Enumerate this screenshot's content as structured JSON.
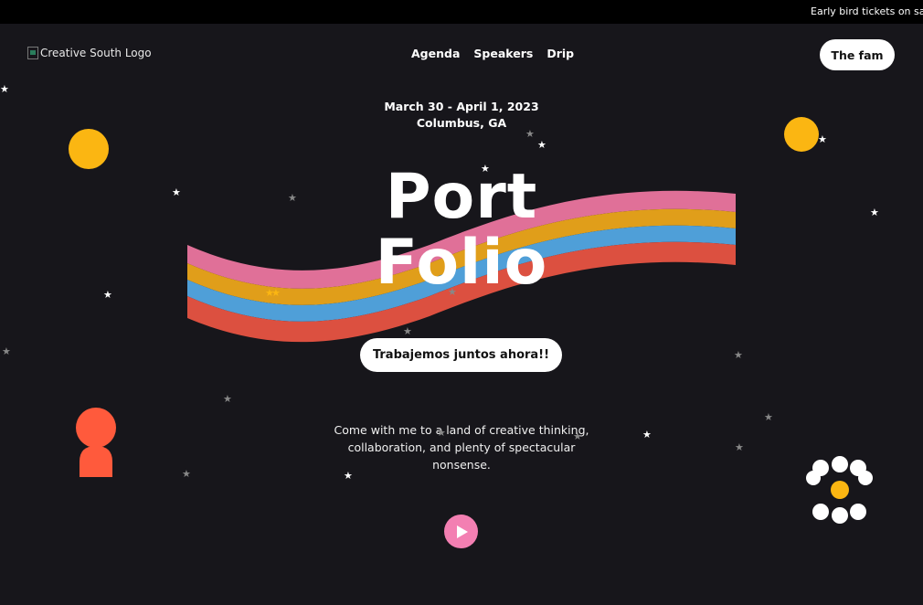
{
  "announcement": {
    "text": "Early bird tickets on sale"
  },
  "header": {
    "logo_alt": "Creative South Logo",
    "nav": [
      "Agenda",
      "Speakers",
      "Drip"
    ],
    "cta_label": "The fam"
  },
  "event": {
    "dates": "March 30 - April 1, 2023",
    "location": "Columbus, GA"
  },
  "hero": {
    "title_line1": "Port",
    "title_line2": "Folio",
    "cta_label": "Trabajemos juntos ahora!!",
    "tagline": "Come with me to a land of creative thinking, collaboration, and plenty of spectacular nonsense."
  },
  "colors": {
    "background": "#17161b",
    "ribbon": [
      "#e07098",
      "#e09e1a",
      "#4f9fd8",
      "#dc5040"
    ],
    "yellow": "#fbb612",
    "coral": "#ff5a3c",
    "play": "#f37fb2"
  },
  "icons": {
    "play": "play-icon",
    "star": "star-icon",
    "logo": "broken-image-icon"
  }
}
